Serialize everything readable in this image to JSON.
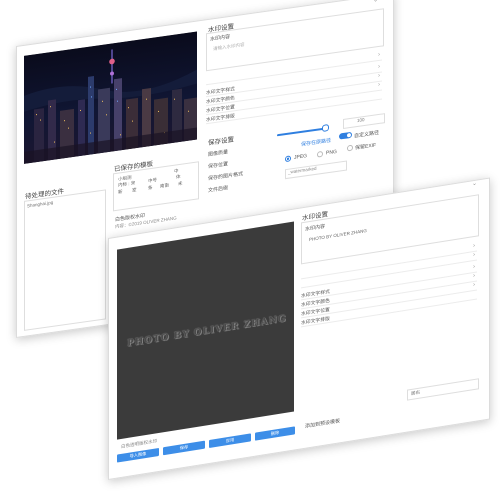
{
  "back": {
    "watermark_settings": "水印设置",
    "watermark_content_label": "水印内容",
    "watermark_content_placeholder": "请输入水印内容",
    "style_label": "水印文字样式",
    "font_label": "水印文字颜色",
    "position_label": "水印文字位置",
    "arrange_label": "水印文字排版",
    "save_settings": "保存设置",
    "image_quality": "图像质量",
    "save_location": "保存位置",
    "save_format": "保存的图片格式",
    "file_suffix": "文件后缀",
    "pending_files": "待处理的文件",
    "file_name": "Shanghai.jpg",
    "saved_templates": "已保存的模板",
    "template_cells": [
      "小组测",
      "内标 : 宋",
      "中号",
      "中",
      "新",
      "室",
      "条",
      "南南",
      "体",
      "未"
    ],
    "template_name": "白色版权水印",
    "template_meta": "内容：©2019 OLIVER ZHANG",
    "quality_value": "100",
    "same_location": "保存在原路径",
    "custom_path": "自定义路径",
    "keep_metadata": "保留EXIF",
    "jpeg": "JPEG",
    "png": "PNG",
    "suffix_value": "_watermarked"
  },
  "front": {
    "watermark_settings": "水印设置",
    "watermark_content_label": "水印内容",
    "watermark_content_value": "PHOTO BY OLIVER ZHANG",
    "style_label": "水印文字样式",
    "font_label": "水印文字颜色",
    "position_label": "水印文字位置",
    "arrange_label": "水印文字排版",
    "watermark_overlay": "PHOTO BY OLIVER ZHANG",
    "preview_label": "白色透明版权水印",
    "btn_add": "导入图像",
    "btn_save": "保存",
    "btn_apply": "应用",
    "btn_delete": "删除",
    "template_apply_label": "添加到预设模板",
    "select_value": "居右",
    "chevron_down": "⌄",
    "chevron_right": "›"
  }
}
